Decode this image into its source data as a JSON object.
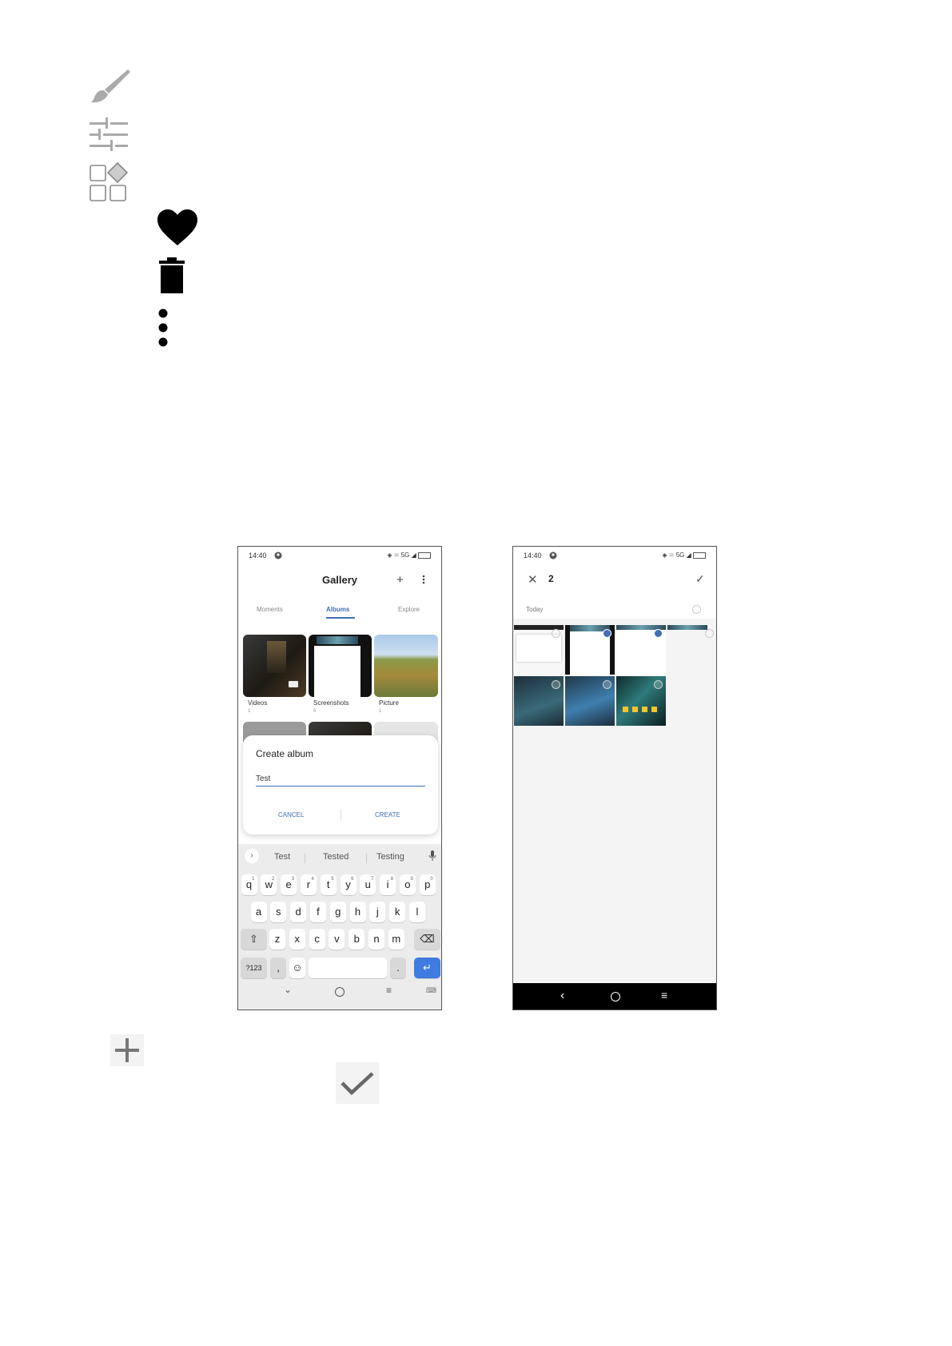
{
  "icons": {
    "left_column": [
      "brush-icon",
      "sliders-icon",
      "add-shape-icon",
      "heart-icon",
      "trash-icon",
      "more-vert-icon"
    ],
    "bottom": [
      "plus-icon",
      "check-icon"
    ]
  },
  "phone1": {
    "status": {
      "time": "14:40",
      "network": "5G"
    },
    "header": {
      "title": "Gallery"
    },
    "tabs": [
      {
        "label": "Moments",
        "active": false
      },
      {
        "label": "Albums",
        "active": true
      },
      {
        "label": "Explore",
        "active": false
      }
    ],
    "albums": [
      {
        "name": "Videos",
        "count": "1"
      },
      {
        "name": "Screenshots",
        "count": "6"
      },
      {
        "name": "Picture",
        "count": "1"
      }
    ],
    "dialog": {
      "title": "Create album",
      "input_value": "Test",
      "cancel_label": "CANCEL",
      "create_label": "CREATE"
    },
    "keyboard": {
      "suggestions": [
        "Test",
        "Tested",
        "Testing"
      ],
      "row1": [
        "q",
        "w",
        "e",
        "r",
        "t",
        "y",
        "u",
        "i",
        "o",
        "p"
      ],
      "row1_hints": [
        "1",
        "2",
        "3",
        "4",
        "5",
        "6",
        "7",
        "8",
        "9",
        "0"
      ],
      "row2": [
        "a",
        "s",
        "d",
        "f",
        "g",
        "h",
        "j",
        "k",
        "l"
      ],
      "row3": [
        "z",
        "x",
        "c",
        "v",
        "b",
        "n",
        "m"
      ],
      "symbols_label": "?123",
      "comma": ",",
      "period": "."
    }
  },
  "phone2": {
    "status": {
      "time": "14:40",
      "network": "5G"
    },
    "selected_count": "2",
    "section_label": "Today",
    "selection": [
      false,
      true,
      true,
      false,
      false,
      false,
      false
    ]
  },
  "colors": {
    "accent": "#3f6fb6",
    "enter_key": "#3f7be0"
  }
}
